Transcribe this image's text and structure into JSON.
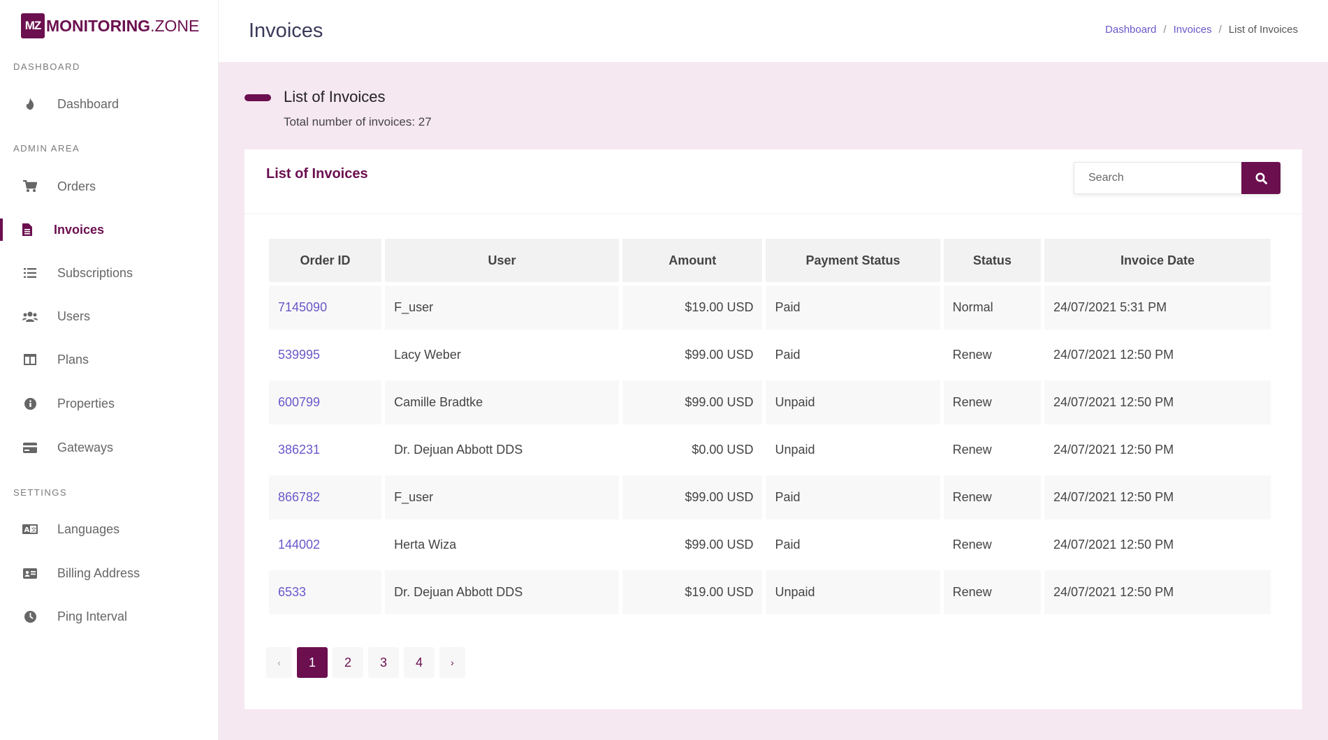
{
  "brand": {
    "badge": "MZ",
    "name_bold": "MONITORING",
    "name_light": ".ZONE"
  },
  "sidebar": {
    "sections": [
      {
        "label": "DASHBOARD"
      },
      {
        "label": "ADMIN AREA"
      },
      {
        "label": "SETTINGS"
      }
    ],
    "items": [
      {
        "label": "Dashboard",
        "icon": "fire-icon"
      },
      {
        "label": "Orders",
        "icon": "cart-icon"
      },
      {
        "label": "Invoices",
        "icon": "file-icon",
        "active": true
      },
      {
        "label": "Subscriptions",
        "icon": "list-icon"
      },
      {
        "label": "Users",
        "icon": "users-icon"
      },
      {
        "label": "Plans",
        "icon": "columns-icon"
      },
      {
        "label": "Properties",
        "icon": "info-icon"
      },
      {
        "label": "Gateways",
        "icon": "credit-card-icon"
      },
      {
        "label": "Languages",
        "icon": "language-icon"
      },
      {
        "label": "Billing Address",
        "icon": "address-card-icon"
      },
      {
        "label": "Ping Interval",
        "icon": "clock-icon"
      }
    ]
  },
  "header": {
    "title": "Invoices",
    "breadcrumb": [
      "Dashboard",
      "Invoices",
      "List of Invoices"
    ],
    "breadcrumb_sep": "/"
  },
  "section": {
    "title": "List of Invoices",
    "subtitle": "Total number of invoices: 27"
  },
  "card": {
    "title": "List of Invoices",
    "search_placeholder": "Search"
  },
  "table": {
    "columns": [
      "Order ID",
      "User",
      "Amount",
      "Payment Status",
      "Status",
      "Invoice Date"
    ],
    "rows": [
      [
        "7145090",
        "F_user",
        "$19.00 USD",
        "Paid",
        "Normal",
        "24/07/2021 5:31 PM"
      ],
      [
        "539995",
        "Lacy Weber",
        "$99.00 USD",
        "Paid",
        "Renew",
        "24/07/2021 12:50 PM"
      ],
      [
        "600799",
        "Camille Bradtke",
        "$99.00 USD",
        "Unpaid",
        "Renew",
        "24/07/2021 12:50 PM"
      ],
      [
        "386231",
        "Dr. Dejuan Abbott DDS",
        "$0.00 USD",
        "Unpaid",
        "Renew",
        "24/07/2021 12:50 PM"
      ],
      [
        "866782",
        "F_user",
        "$99.00 USD",
        "Paid",
        "Renew",
        "24/07/2021 12:50 PM"
      ],
      [
        "144002",
        "Herta Wiza",
        "$99.00 USD",
        "Paid",
        "Renew",
        "24/07/2021 12:50 PM"
      ],
      [
        "6533",
        "Dr. Dejuan Abbott DDS",
        "$19.00 USD",
        "Unpaid",
        "Renew",
        "24/07/2021 12:50 PM"
      ]
    ]
  },
  "pagination": {
    "prev": "‹",
    "pages": [
      "1",
      "2",
      "3",
      "4"
    ],
    "current": "1",
    "next": "›"
  },
  "colors": {
    "primary": "#6b0f4f",
    "link": "#6b57c9",
    "background": "#f6e8f1"
  }
}
